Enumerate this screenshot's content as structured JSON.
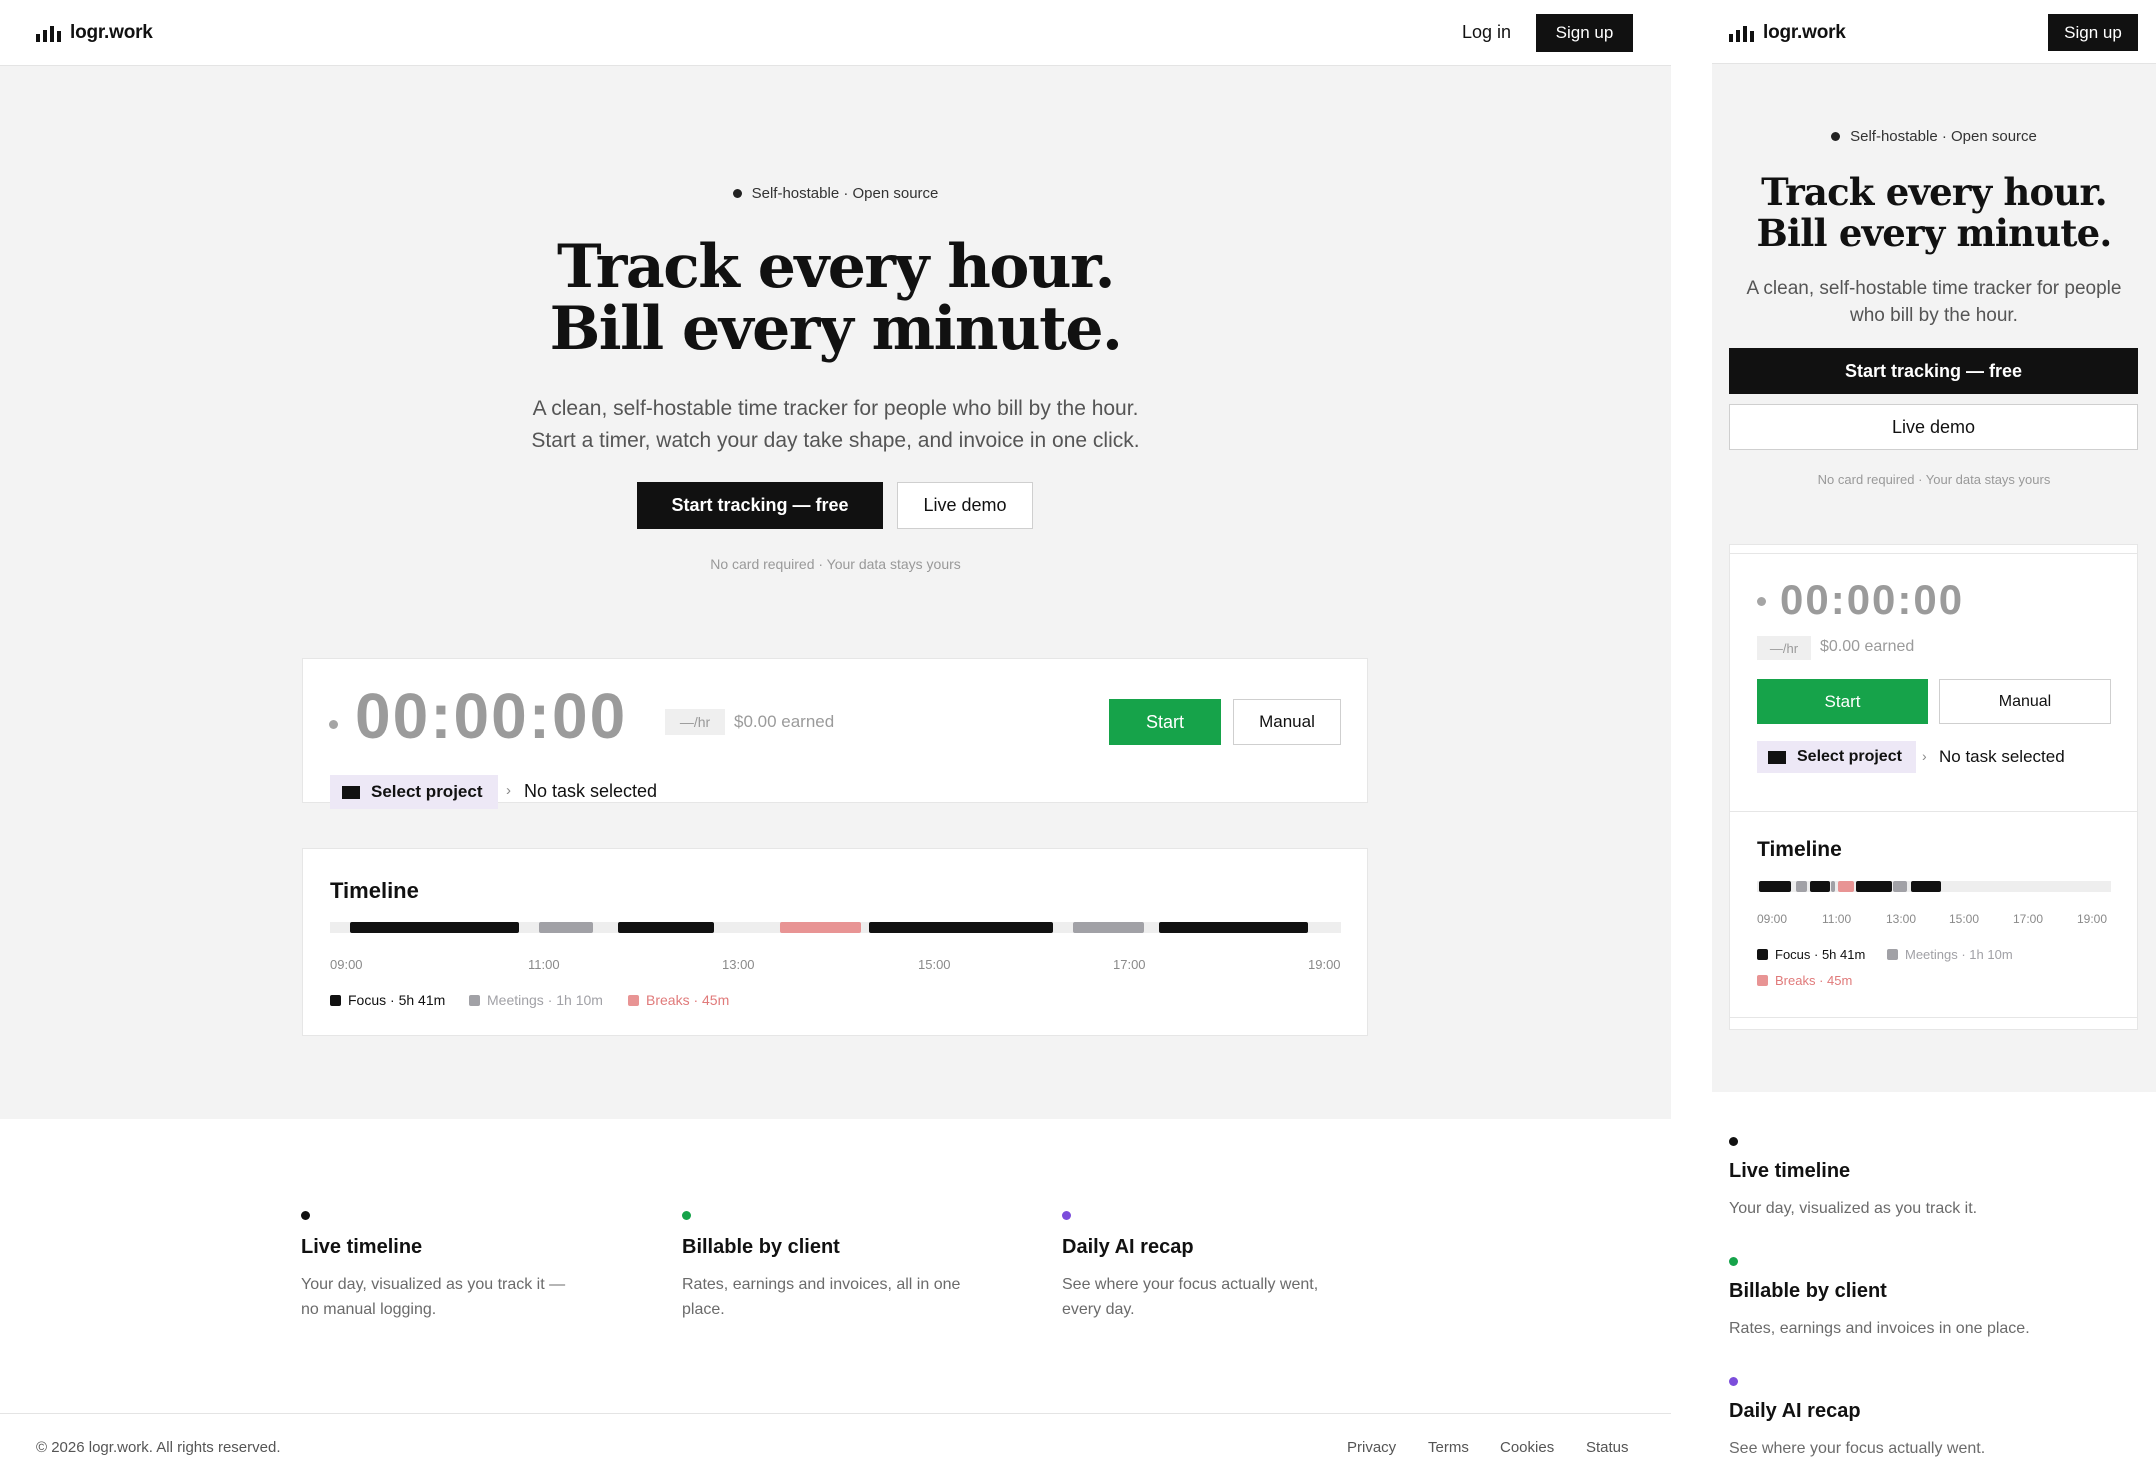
{
  "brand": {
    "name": "logr.work"
  },
  "nav": {
    "login": "Log in",
    "signup": "Sign up"
  },
  "hero": {
    "badge": "Self-hostable · Open source",
    "title_line1": "Track every hour.",
    "title_line2": "Bill every minute.",
    "subtitle_line1": "A clean, self-hostable time tracker for people who bill by the hour.",
    "subtitle_line2": "Start a timer, watch your day take shape, and invoice in one click.",
    "cta_primary": "Start tracking — free",
    "cta_secondary": "Live demo",
    "note": "No card required · Your data stays yours"
  },
  "timer": {
    "display": "00:00:00",
    "rate": "—/hr",
    "earned": "$0.00 earned",
    "start": "Start",
    "manual": "Manual",
    "project": "Select project",
    "separator": "›",
    "task": "No task selected"
  },
  "timeline": {
    "title": "Timeline",
    "ticks": [
      "09:00",
      "11:00",
      "13:00",
      "15:00",
      "17:00",
      "19:00"
    ],
    "range": [
      9,
      19
    ],
    "segments": [
      {
        "kind": "focus",
        "start": 9.2,
        "end": 10.87
      },
      {
        "kind": "meetings",
        "start": 11.07,
        "end": 11.6
      },
      {
        "kind": "focus",
        "start": 11.85,
        "end": 12.8
      },
      {
        "kind": "breaks",
        "start": 13.45,
        "end": 14.25
      },
      {
        "kind": "focus",
        "start": 14.33,
        "end": 16.15
      },
      {
        "kind": "meetings",
        "start": 16.35,
        "end": 17.05
      },
      {
        "kind": "focus",
        "start": 17.2,
        "end": 18.67
      }
    ],
    "mobile_segments": [
      {
        "kind": "focus",
        "start": 9.05,
        "end": 9.95
      },
      {
        "kind": "meetings",
        "start": 10.1,
        "end": 10.4
      },
      {
        "kind": "focus",
        "start": 10.5,
        "end": 11.05
      },
      {
        "kind": "meetings",
        "start": 11.1,
        "end": 11.2
      },
      {
        "kind": "breaks",
        "start": 11.3,
        "end": 11.75
      },
      {
        "kind": "focus",
        "start": 11.8,
        "end": 12.8
      },
      {
        "kind": "meetings",
        "start": 12.85,
        "end": 13.25
      },
      {
        "kind": "focus",
        "start": 13.35,
        "end": 14.2
      }
    ],
    "legend": [
      {
        "kind": "focus",
        "label": "Focus · 5h 41m"
      },
      {
        "kind": "meetings",
        "label": "Meetings · 1h 10m"
      },
      {
        "kind": "breaks",
        "label": "Breaks · 45m"
      }
    ],
    "colors": {
      "focus": "#111111",
      "meetings": "#a1a1a6",
      "breaks": "#e89494"
    }
  },
  "features": [
    {
      "color": "#111111",
      "title": "Live timeline",
      "desc_line1": "Your day, visualized as you track it —",
      "desc_line2": "no manual logging.",
      "mobile_desc": "Your day, visualized as you track it."
    },
    {
      "color": "#16a34a",
      "title": "Billable by client",
      "desc_line1": "Rates, earnings and invoices, all in one",
      "desc_line2": "place.",
      "mobile_desc": "Rates, earnings and invoices in one place."
    },
    {
      "color": "#7c4ddb",
      "title": "Daily AI recap",
      "desc_line1": "See where your focus actually went,",
      "desc_line2": "every day.",
      "mobile_desc": "See where your focus actually went."
    }
  ],
  "footer": {
    "copyright": "© 2026 logr.work. All rights reserved.",
    "links": [
      "Privacy",
      "Terms",
      "Cookies",
      "Status"
    ]
  }
}
